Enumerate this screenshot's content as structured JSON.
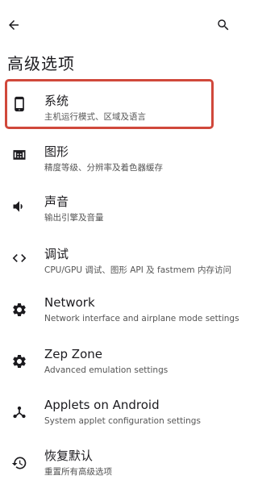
{
  "header": {
    "title": "高级选项",
    "back_icon": "arrow-left-icon",
    "search_icon": "search-icon"
  },
  "highlight_color": "#d0483b",
  "items": [
    {
      "title": "系统",
      "subtitle": "主机运行模式、区域及语言",
      "icon": "phone-icon"
    },
    {
      "title": "图形",
      "subtitle": "精度等级、分辨率及着色器缓存",
      "icon": "chip-icon"
    },
    {
      "title": "声音",
      "subtitle": "输出引擎及音量",
      "icon": "volume-icon"
    },
    {
      "title": "调试",
      "subtitle": "CPU/GPU 调试、图形 API 及 fastmem 内存访问",
      "icon": "code-icon"
    },
    {
      "title": "Network",
      "subtitle": "Network interface and airplane mode settings",
      "icon": "gear-icon"
    },
    {
      "title": "Zep Zone",
      "subtitle": "Advanced emulation settings",
      "icon": "gear-icon"
    },
    {
      "title": "Applets on Android",
      "subtitle": "System applet configuration settings",
      "icon": "share-nodes-icon"
    },
    {
      "title": "恢复默认",
      "subtitle": "重置所有高级选项",
      "icon": "history-icon"
    }
  ]
}
